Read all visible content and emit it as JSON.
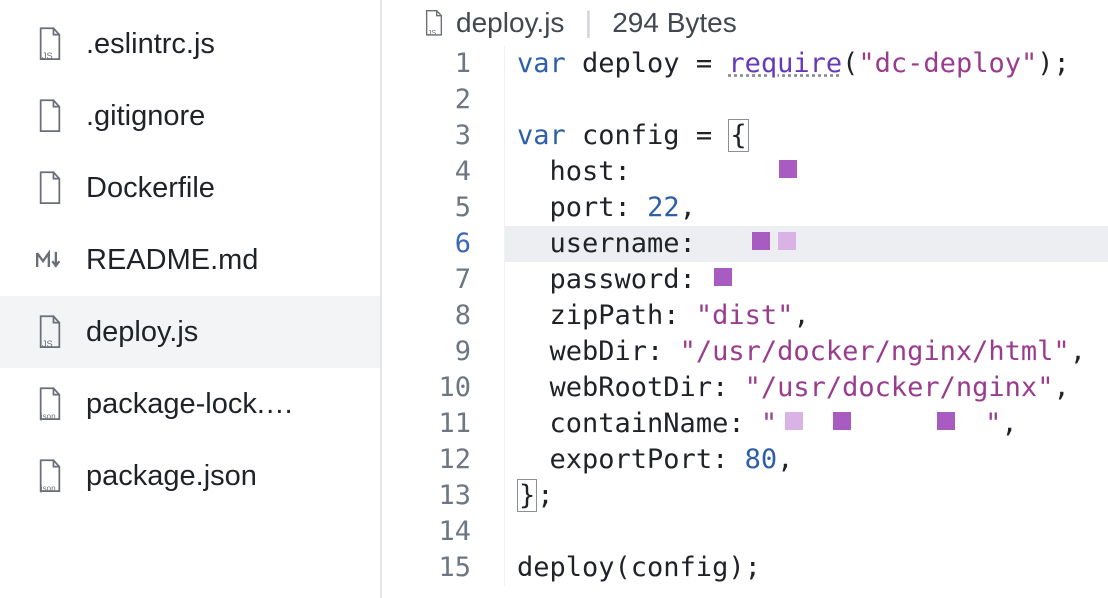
{
  "sidebar": {
    "files": [
      {
        "name": ".eslintrc.js",
        "icon": "js-file",
        "selected": false
      },
      {
        "name": ".gitignore",
        "icon": "file",
        "selected": false
      },
      {
        "name": "Dockerfile",
        "icon": "file",
        "selected": false
      },
      {
        "name": "README.md",
        "icon": "md-file",
        "selected": false
      },
      {
        "name": "deploy.js",
        "icon": "js-file",
        "selected": true
      },
      {
        "name": "package-lock.…",
        "icon": "json-file",
        "selected": false
      },
      {
        "name": "package.json",
        "icon": "json-file",
        "selected": false
      }
    ]
  },
  "header": {
    "file_name": "deploy.js",
    "file_size": "294 Bytes"
  },
  "editor": {
    "active_line": 6,
    "line_count": 15,
    "lines": {
      "l1": {
        "var": "var ",
        "ident": "deploy = ",
        "req": "require",
        "paren1": "(",
        "str": "\"dc-deploy\"",
        "paren2": ");"
      },
      "l3": {
        "var": "var ",
        "ident": "config = ",
        "brace": "{"
      },
      "l4": {
        "indent": "  ",
        "key": "host:",
        "sp": " "
      },
      "l5": {
        "indent": "  ",
        "key": "port: ",
        "num": "22",
        "comma": ","
      },
      "l6": {
        "indent": "  ",
        "key": "username:",
        "sp": " "
      },
      "l7": {
        "indent": "  ",
        "key": "password:",
        "sp": " "
      },
      "l8": {
        "indent": "  ",
        "key": "zipPath: ",
        "str": "\"dist\"",
        "comma": ","
      },
      "l9": {
        "indent": "  ",
        "key": "webDir: ",
        "str": "\"/usr/docker/nginx/html\"",
        "comma": ","
      },
      "l10": {
        "indent": "  ",
        "key": "webRootDir: ",
        "str": "\"/usr/docker/nginx\"",
        "comma": ","
      },
      "l11": {
        "indent": "  ",
        "key": "containName: ",
        "q1": "\"",
        "q2": "\"",
        "comma": ","
      },
      "l12": {
        "indent": "  ",
        "key": "exportPort: ",
        "num": "80",
        "comma": ","
      },
      "l13": {
        "brace": "}",
        "semi": ";"
      },
      "l15": {
        "call": "deploy(config);"
      }
    }
  }
}
